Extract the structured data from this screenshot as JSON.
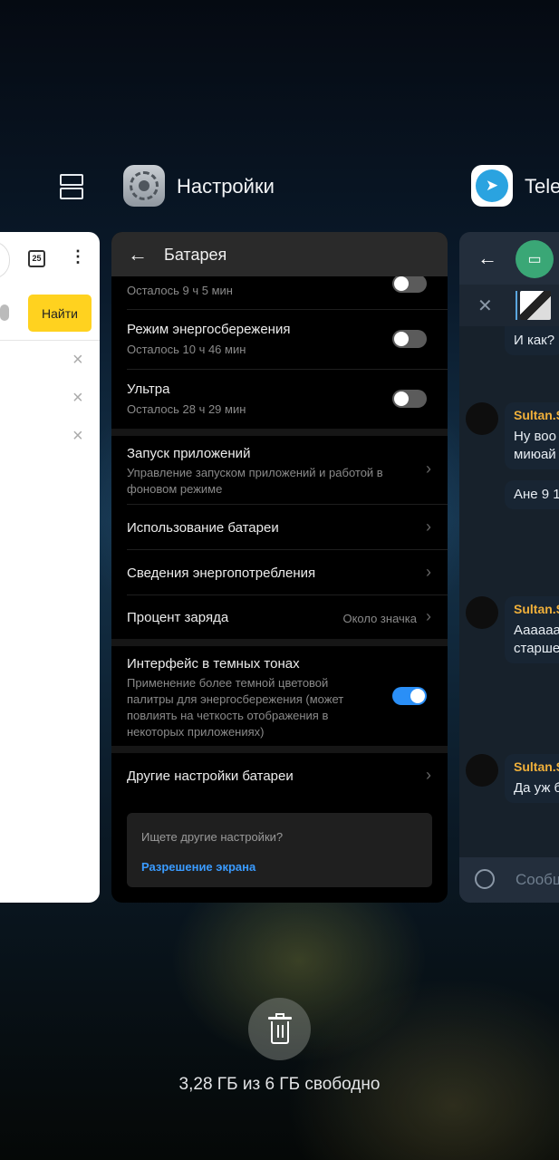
{
  "recents": {
    "settings_title": "Настройки",
    "telegram_title": "Tele",
    "memory_text": "3,28 ГБ из 6 ГБ свободно"
  },
  "browser_card": {
    "tabs_count": "25",
    "find_button": "Найти",
    "history_close": [
      "×",
      "×",
      "×"
    ]
  },
  "settings": {
    "back_icon": "←",
    "title": "Батарея",
    "partial_row_sub": "Осталось 9 ч 5 мин",
    "rows": [
      {
        "title": "Режим энергосбережения",
        "sub": "Осталось 10 ч 46 мин",
        "on": false
      },
      {
        "title": "Ультра",
        "sub": "Осталось 28 ч 29 мин",
        "on": false
      }
    ],
    "app_launch": {
      "title": "Запуск приложений",
      "sub": "Управление запуском приложений и работой в фоновом режиме"
    },
    "battery_usage": "Использование батареи",
    "power_info": "Сведения энергопотребления",
    "charge_percent": {
      "title": "Процент заряда",
      "value": "Около значка"
    },
    "dark_mode": {
      "title": "Интерфейс в темных тонах",
      "sub": "Применение более темной цветовой палитры для энергосбережения (может повлиять на четкость отображения в некоторых приложениях)",
      "on": true
    },
    "more_settings": "Другие настройки батареи",
    "hint_question": "Ищете другие настройки?",
    "hint_link": "Разрешение экрана"
  },
  "telegram": {
    "back_icon": "←",
    "close_icon": "✕",
    "messages": [
      {
        "lines": [
          "И как?"
        ]
      },
      {
        "name": "Sultan.S",
        "lines": [
          "Ну воо",
          "миюай"
        ]
      },
      {
        "lines": [
          "Ане 9 1"
        ]
      },
      {
        "name": "Sultan.S",
        "lines": [
          "Аааааа",
          "старше"
        ]
      },
      {
        "name": "Sultan.S",
        "lines": [
          "Да уж б"
        ]
      }
    ],
    "input_placeholder": "Сообщ"
  },
  "colors": {
    "accent": "#2a8ff7",
    "link": "#3a9bff",
    "find_button": "#ffd21f",
    "tg_name": "#f0b03a"
  }
}
